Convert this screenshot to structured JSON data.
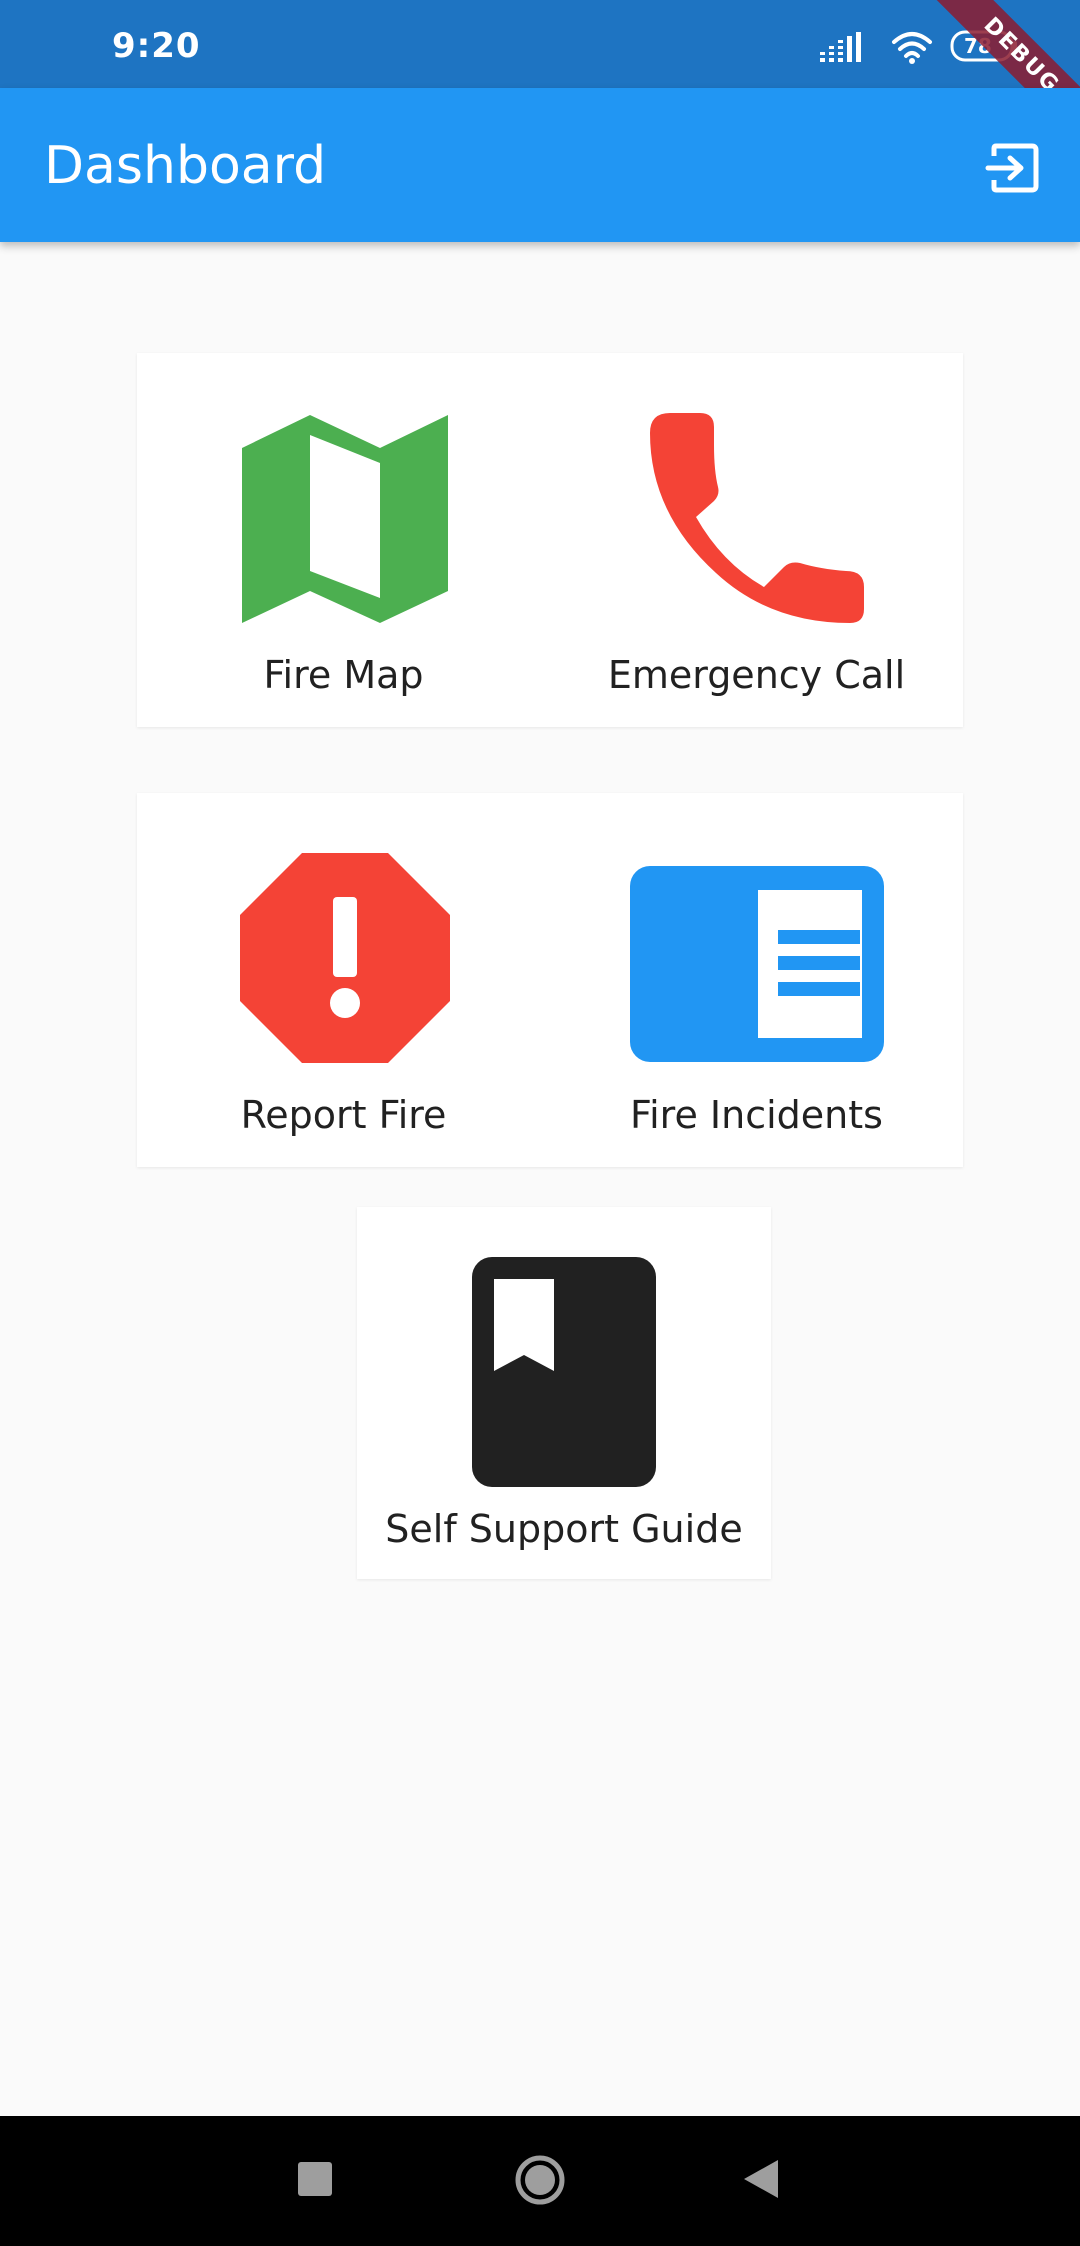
{
  "status_bar": {
    "time": "9:20",
    "battery": "78",
    "debug_banner": "DEBUG"
  },
  "app_bar": {
    "title": "Dashboard",
    "action_icon": "logout-icon"
  },
  "tiles": [
    {
      "label": "Fire Map",
      "icon": "map-icon",
      "color": "#4caf50"
    },
    {
      "label": "Emergency Call",
      "icon": "phone-icon",
      "color": "#f44336"
    },
    {
      "label": "Report Fire",
      "icon": "report-icon",
      "color": "#f44336"
    },
    {
      "label": "Fire Incidents",
      "icon": "article-icon",
      "color": "#2196f3"
    },
    {
      "label": "Self Support Guide",
      "icon": "book-icon",
      "color": "#212121"
    }
  ],
  "nav_bar": {
    "buttons": [
      "recents-icon",
      "home-icon",
      "back-icon"
    ]
  },
  "colors": {
    "status_bar": "#1e74c2",
    "app_bar": "#2196f3",
    "background": "#fafafa"
  }
}
